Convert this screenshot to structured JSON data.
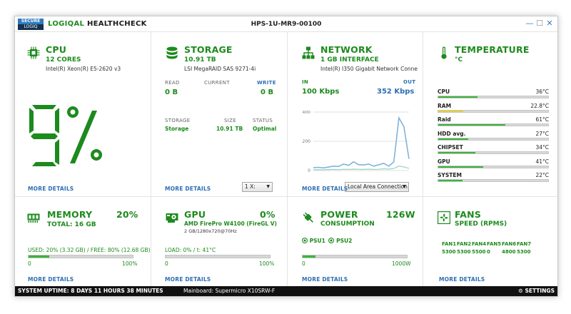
{
  "app": {
    "logo_top": "SECURE",
    "logo_bottom": "LOGIQ",
    "title_accent": "LOGIQAL",
    "title_rest": " HEALTHCHECK",
    "hostname": "HPS-1U-MR9-00100",
    "win_min": "—",
    "win_max": "☐",
    "win_close": "✕"
  },
  "cpu": {
    "title": "CPU",
    "cores": "12 CORES",
    "model": "Intel(R) Xeon(R)   E5-2620 v3",
    "usage_pct": 9,
    "usage_display": "9%",
    "more": "MORE DETAILS",
    "icon": "cpu-chip-icon"
  },
  "storage": {
    "title": "STORAGE",
    "size": "10.91 TB",
    "controller": "LSI MegaRAID SAS 9271-4i",
    "read_label": "READ",
    "current_label": "CURRENT",
    "write_label": "WRITE",
    "read_value": "0 B",
    "write_value": "0 B",
    "col_storage": "STORAGE",
    "col_size": "SIZE",
    "col_status": "STATUS",
    "rows": [
      {
        "name": "Storage",
        "size": "10.91 TB",
        "status": "Optimal"
      }
    ],
    "select_value": "1 X:",
    "more": "MORE DETAILS",
    "icon": "database-icon"
  },
  "network": {
    "title": "NETWORK",
    "interface": "1 GB INTERFACE",
    "adapter": "Intel(R) I350 Gigabit Network Conne",
    "in_label": "IN",
    "out_label": "OUT",
    "in_value": "100 Kbps",
    "out_value": "352 Kbps",
    "select_value": "Local Area Connection",
    "more": "MORE DETAILS",
    "icon": "network-topology-icon"
  },
  "temperature": {
    "title": "TEMPERATURE",
    "unit": "°C",
    "rows": [
      {
        "name": "CPU",
        "value": "36°C",
        "fill": 0.36,
        "color": "#3bb33b"
      },
      {
        "name": "RAM",
        "value": "22.8°C",
        "fill": 0.23,
        "color": "#e3d235"
      },
      {
        "name": "Raid",
        "value": "61°C",
        "fill": 0.61,
        "color": "#3bb33b"
      },
      {
        "name": "HDD avg.",
        "value": "27°C",
        "fill": 0.27,
        "color": "#3bb33b"
      },
      {
        "name": "CHIPSET",
        "value": "34°C",
        "fill": 0.34,
        "color": "#3bb33b"
      },
      {
        "name": "GPU",
        "value": "41°C",
        "fill": 0.41,
        "color": "#3bb33b"
      },
      {
        "name": "SYSTEM",
        "value": "22°C",
        "fill": 0.22,
        "color": "#3bb33b"
      }
    ],
    "icon": "thermometer-icon"
  },
  "memory": {
    "title": "MEMORY",
    "pct": "20%",
    "total": "TOTAL: 16 GB",
    "usage": "USED: 20%  (3.32 GB) / FREE: 80%  (12.68 GB)",
    "fill": 0.2,
    "min": "0",
    "max": "100%",
    "more": "MORE DETAILS",
    "icon": "ram-module-icon"
  },
  "gpu": {
    "title": "GPU",
    "pct": "0%",
    "model": "AMD FirePro W4100 (FireGL V)",
    "detail": "2 GB/1280x720@70Hz",
    "load": "LOAD:  0%  /  t:  41°C",
    "fill": 0.0,
    "min": "0",
    "max": "100%",
    "more": "MORE DETAILS",
    "icon": "graphics-card-icon"
  },
  "power": {
    "title": "POWER",
    "subtitle": "CONSUMPTION",
    "watts": "126W",
    "psu1": "PSU1",
    "psu2": "PSU2",
    "fill": 0.126,
    "min": "0",
    "max": "1000W",
    "more": "MORE DETAILS",
    "icon": "power-plug-icon"
  },
  "fans": {
    "title": "FANS",
    "subtitle": "SPEED (RPMS)",
    "names": [
      "FAN1",
      "FAN2",
      "FAN4",
      "FAN5",
      "FAN6",
      "FAN7"
    ],
    "values": [
      "5300",
      "5300",
      "5500",
      "0",
      "4800",
      "5300"
    ],
    "more": "MORE DETAILS",
    "icon": "fan-icon"
  },
  "status": {
    "uptime": "SYSTEM UPTIME:   8 DAYS   11 HOURS   38 MINUTES",
    "mainboard": "Mainboard:   Supermicro X10SRW-F",
    "settings": "SETTINGS"
  },
  "colors": {
    "accent_green": "#1d8a1d",
    "link_blue": "#2c6fb3",
    "chart_line": "#7fb3dc",
    "chart_line_in": "#98d1c2"
  },
  "chart_data": {
    "type": "line",
    "title": "",
    "xlabel": "",
    "ylabel": "",
    "ylim": [
      0,
      400
    ],
    "yticks": [
      0,
      200,
      400
    ],
    "series": [
      {
        "name": "OUT",
        "values": [
          20,
          22,
          18,
          24,
          30,
          28,
          45,
          35,
          60,
          40,
          38,
          45,
          30,
          40,
          50,
          30,
          60,
          360,
          300,
          80
        ]
      },
      {
        "name": "IN",
        "values": [
          5,
          6,
          5,
          7,
          8,
          6,
          9,
          8,
          10,
          9,
          8,
          10,
          8,
          9,
          12,
          10,
          14,
          30,
          25,
          15
        ]
      }
    ]
  }
}
